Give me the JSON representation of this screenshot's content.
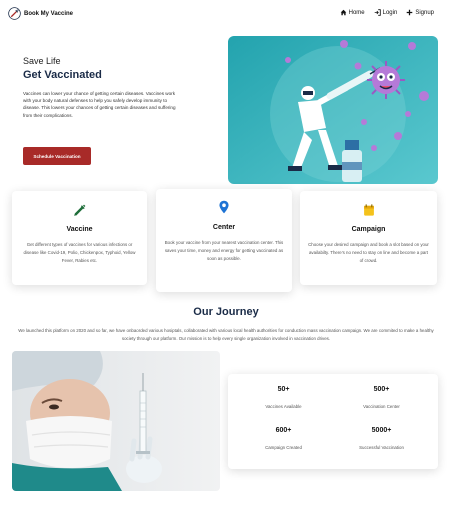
{
  "nav": {
    "brand": "Book My Vaccine",
    "links": [
      {
        "label": "Home",
        "icon": "home-icon"
      },
      {
        "label": "Login",
        "icon": "login-icon"
      },
      {
        "label": "Signup",
        "icon": "plus-icon"
      }
    ]
  },
  "hero": {
    "subtitle": "Save Life",
    "title": "Get Vaccinated",
    "text": "Vaccines can lower your chance of getting certain diseases. Vaccines work with your body natural defenses to help you safely develop immunity to disease. This lowers your chances of getting certain diseases and suffering from their complications.",
    "button": "Schedule Vaccination",
    "accent": "#a82a28"
  },
  "cards": [
    {
      "icon": "syringe-icon",
      "title": "Vaccine",
      "text": "Get different types of vaccines for various infections or disease like Covid-19, Polio, Chickenpox, Typhoid, Yellow Fever, Rabies etc."
    },
    {
      "icon": "location-pin-icon",
      "title": "Center",
      "text": "Book your vaccine from your nearest vaccination center. This saves your time, money and energy for getting vaccinated as soon as possible."
    },
    {
      "icon": "calendar-icon",
      "title": "Campaign",
      "text": "Choose your desired campaign and book a slot based on your availabilty. There's no need to stay on line and become a part of crowd."
    }
  ],
  "journey": {
    "title": "Our Journey",
    "text": "We launched this platform on 2020 and so far, we have onbaorded various hosiptals, collaborated with various local health authorities for conduction mass vaccination campaign. We are commited to make a healthy society through our platform. Our mission is to help every single organization involved in vaccination drives."
  },
  "stats": [
    {
      "value": "50+",
      "label": "Vaccines Available"
    },
    {
      "value": "500+",
      "label": "Vaccination Center"
    },
    {
      "value": "600+",
      "label": "Campaign Created"
    },
    {
      "value": "5000+",
      "label": "Successful Vaccination"
    }
  ]
}
